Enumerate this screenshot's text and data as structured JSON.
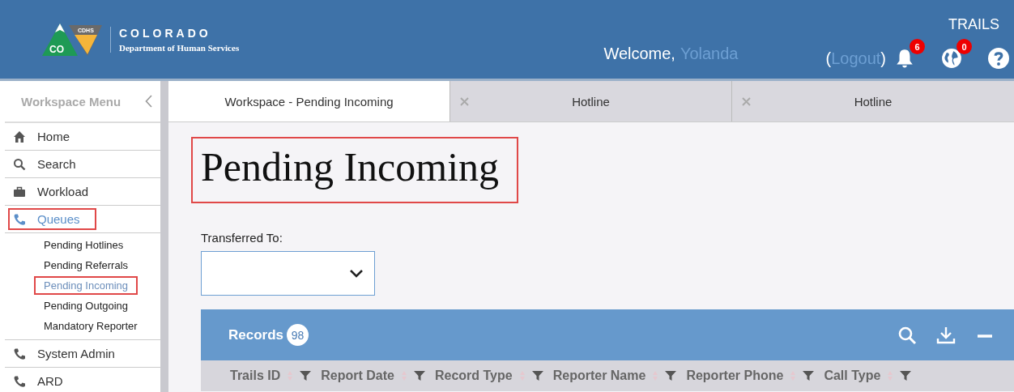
{
  "header": {
    "logo_text": "CO",
    "logo_badge": "CDHS",
    "brand": "COLORADO",
    "department": "Department of Human Services",
    "app_name": "TRAILS",
    "welcome": "Welcome,",
    "user": "Yolanda",
    "logout_open": "(",
    "logout": "Logout",
    "logout_close": ")",
    "notifications": "6",
    "messages": "0"
  },
  "sidebar": {
    "title": "Workspace Menu",
    "items": [
      {
        "kind": "main",
        "label": "Home",
        "selected": false,
        "highlighted": false
      },
      {
        "kind": "main",
        "label": "Search",
        "selected": false,
        "highlighted": false
      },
      {
        "kind": "main",
        "label": "Workload",
        "selected": false,
        "highlighted": false
      },
      {
        "kind": "main",
        "label": "Queues",
        "selected": true,
        "highlighted": true
      },
      {
        "kind": "sub",
        "label": "Pending Hotlines",
        "selected": false,
        "highlighted": false
      },
      {
        "kind": "sub",
        "label": "Pending Referrals",
        "selected": false,
        "highlighted": false
      },
      {
        "kind": "sub",
        "label": "Pending Incoming",
        "selected": true,
        "highlighted": true
      },
      {
        "kind": "sub",
        "label": "Pending Outgoing",
        "selected": false,
        "highlighted": false
      },
      {
        "kind": "sub",
        "label": "Mandatory Reporter",
        "selected": false,
        "highlighted": false
      },
      {
        "kind": "main",
        "label": "System Admin",
        "selected": false,
        "highlighted": false
      },
      {
        "kind": "main",
        "label": "ARD",
        "selected": false,
        "highlighted": false
      }
    ]
  },
  "tabs": [
    {
      "label": "Workspace - Pending Incoming",
      "selected": true,
      "closable": false
    },
    {
      "label": "Hotline",
      "selected": false,
      "closable": true
    },
    {
      "label": "Hotline",
      "selected": false,
      "closable": true
    }
  ],
  "page": {
    "title": "Pending Incoming",
    "title_highlighted": true,
    "filter_label": "Transferred To:"
  },
  "records": {
    "title": "Records",
    "count": "98",
    "columns": [
      "Trails ID",
      "Report Date",
      "Record Type",
      "Reporter Name",
      "Reporter Phone",
      "Call Type"
    ]
  }
}
